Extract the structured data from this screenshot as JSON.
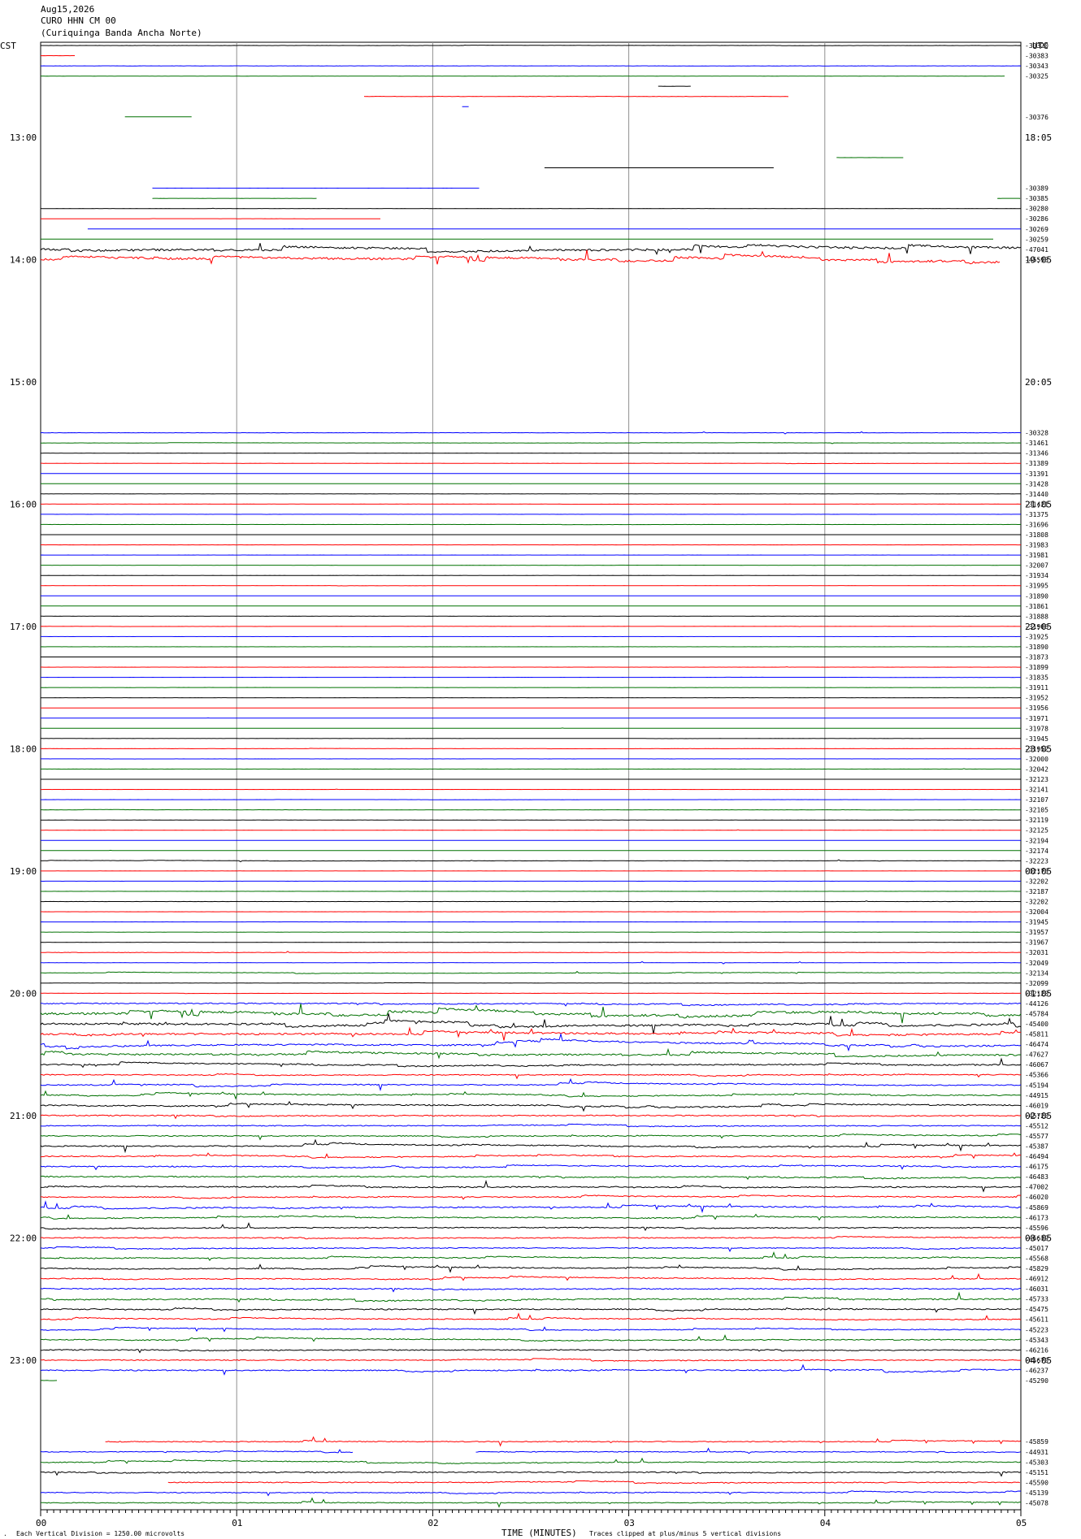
{
  "header": {
    "date": "Aug15,2026",
    "station": "CURO HHN CM 00",
    "location": "(Curiquinga Banda Ancha Norte)"
  },
  "left_tz": "CST",
  "right_tz": "UTC",
  "footer": {
    "scale": "Each Vertical Division = 1250.00 microvolts",
    "xlabel": "TIME (MINUTES)",
    "clip": "Traces clipped at plus/minus 5 vertical divisions"
  },
  "colors": {
    "cycle": [
      "#000000",
      "#ff0000",
      "#0000ff",
      "#007000"
    ],
    "grid": "#909090"
  },
  "chart_data": {
    "type": "line",
    "title": "",
    "xlabel": "TIME (MINUTES)",
    "xlim": [
      0,
      5
    ],
    "x_ticks": [
      "00",
      "01",
      "02",
      "03",
      "04",
      "05"
    ],
    "traces_per_hour": 12,
    "first_trace_hour": 12.25,
    "left_hour_labels": [
      "13:00",
      "14:00",
      "15:00",
      "16:00",
      "17:00",
      "18:00",
      "19:00",
      "20:00",
      "21:00",
      "22:00",
      "23:00"
    ],
    "right_hour_labels": [
      "18:05",
      "19:05",
      "20:05",
      "21:05",
      "22:05",
      "23:05",
      "00:05",
      "01:05",
      "02:05",
      "03:05",
      "04:05"
    ],
    "rows": [
      {
        "id": 0,
        "off": "-30320",
        "s": [
          [
            0,
            5
          ]
        ],
        "n": 0.2
      },
      {
        "id": 1,
        "off": "-30383",
        "s": [
          [
            0,
            0.18
          ]
        ],
        "n": 0.1
      },
      {
        "id": 2,
        "off": "-30343",
        "s": [
          [
            0,
            5
          ]
        ],
        "n": 0.2
      },
      {
        "id": 3,
        "off": "-30325",
        "s": [
          [
            0,
            4.92
          ]
        ],
        "n": 0.1
      },
      {
        "id": 4,
        "off": "",
        "s": [
          [
            3.15,
            3.32
          ]
        ],
        "n": 0.1
      },
      {
        "id": 5,
        "off": "",
        "s": [
          [
            1.65,
            3.82
          ]
        ],
        "n": 0.4
      },
      {
        "id": 6,
        "off": "",
        "s": [
          [
            2.15,
            2.19
          ]
        ],
        "n": 0.1
      },
      {
        "id": 7,
        "off": "-30376",
        "s": [
          [
            0.43,
            0.77
          ]
        ],
        "n": 0.1
      },
      {
        "id": 11,
        "off": "",
        "s": [
          [
            4.06,
            4.4
          ]
        ],
        "n": 0.1
      },
      {
        "id": 12,
        "off": "",
        "s": [
          [
            2.57,
            3.74
          ]
        ],
        "n": 0.1
      },
      {
        "id": 14,
        "off": "-30389",
        "s": [
          [
            0.57,
            2.24
          ]
        ],
        "n": 0.1
      },
      {
        "id": 15,
        "off": "-30385",
        "s": [
          [
            0.57,
            1.41
          ],
          [
            4.88,
            5
          ]
        ],
        "n": 0.1
      },
      {
        "id": 16,
        "off": "-30280",
        "s": [
          [
            0,
            5
          ]
        ],
        "n": 0.1
      },
      {
        "id": 17,
        "off": "-30286",
        "s": [
          [
            0,
            1.74
          ]
        ],
        "n": 0.1
      },
      {
        "id": 18,
        "off": "-30269",
        "s": [
          [
            0.24,
            5
          ]
        ],
        "n": 0.1
      },
      {
        "id": 19,
        "off": "-30259",
        "s": [
          [
            0,
            4.86
          ]
        ],
        "n": 0.1
      },
      {
        "id": 20,
        "off": "-47041",
        "s": [
          [
            0,
            5
          ]
        ],
        "n": 2.5
      },
      {
        "id": 21,
        "off": "-45593",
        "s": [
          [
            0,
            4.9
          ]
        ],
        "n": 2.5
      },
      {
        "id": 38,
        "off": "-30328",
        "s": [
          [
            0,
            5
          ]
        ],
        "n": 0.3
      },
      {
        "id": 39,
        "off": "-31461",
        "s": [
          [
            0,
            5
          ]
        ],
        "n": 0.2
      },
      {
        "id": 40,
        "off": "-31346",
        "s": [
          [
            0,
            5
          ]
        ],
        "n": 0.1
      },
      {
        "id": 41,
        "off": "-31389",
        "s": [
          [
            0,
            5
          ]
        ],
        "n": 0.3
      },
      {
        "id": 42,
        "off": "-31391",
        "s": [
          [
            0,
            5
          ]
        ],
        "n": 0.1
      },
      {
        "id": 43,
        "off": "-31428",
        "s": [
          [
            0,
            5
          ]
        ],
        "n": 0.1
      },
      {
        "id": 44,
        "off": "-31440",
        "s": [
          [
            0,
            5
          ]
        ],
        "n": 0.1
      },
      {
        "id": 45,
        "off": "-31421",
        "s": [
          [
            0,
            5
          ]
        ],
        "n": 0.1
      },
      {
        "id": 46,
        "off": "-31375",
        "s": [
          [
            0,
            5
          ]
        ],
        "n": 0.1
      },
      {
        "id": 47,
        "off": "-31696",
        "s": [
          [
            0,
            5
          ]
        ],
        "n": 0.2
      },
      {
        "id": 48,
        "off": "-31808",
        "s": [
          [
            0,
            5
          ]
        ],
        "n": 0.1
      },
      {
        "id": 49,
        "off": "-31983",
        "s": [
          [
            0,
            5
          ]
        ],
        "n": 0.1
      },
      {
        "id": 50,
        "off": "-31981",
        "s": [
          [
            0,
            5
          ]
        ],
        "n": 0.1
      },
      {
        "id": 51,
        "off": "-32007",
        "s": [
          [
            0,
            5
          ]
        ],
        "n": 0.1
      },
      {
        "id": 52,
        "off": "-31934",
        "s": [
          [
            0,
            5
          ]
        ],
        "n": 0.1
      },
      {
        "id": 53,
        "off": "-31995",
        "s": [
          [
            0,
            5
          ]
        ],
        "n": 0.2
      },
      {
        "id": 54,
        "off": "-31890",
        "s": [
          [
            0,
            5
          ]
        ],
        "n": 0.1
      },
      {
        "id": 55,
        "off": "-31861",
        "s": [
          [
            0,
            5
          ]
        ],
        "n": 0.1
      },
      {
        "id": 56,
        "off": "-31888",
        "s": [
          [
            0,
            5
          ]
        ],
        "n": 0.1
      },
      {
        "id": 57,
        "off": "-31906",
        "s": [
          [
            0,
            5
          ]
        ],
        "n": 0.1
      },
      {
        "id": 58,
        "off": "-31925",
        "s": [
          [
            0,
            5
          ]
        ],
        "n": 0.1
      },
      {
        "id": 59,
        "off": "-31890",
        "s": [
          [
            0,
            5
          ]
        ],
        "n": 0.1
      },
      {
        "id": 60,
        "off": "-31873",
        "s": [
          [
            0,
            5
          ]
        ],
        "n": 0.1
      },
      {
        "id": 61,
        "off": "-31899",
        "s": [
          [
            0,
            5
          ]
        ],
        "n": 0.1
      },
      {
        "id": 62,
        "off": "-31835",
        "s": [
          [
            0,
            5
          ]
        ],
        "n": 0.1
      },
      {
        "id": 63,
        "off": "-31911",
        "s": [
          [
            0,
            5
          ]
        ],
        "n": 0.1
      },
      {
        "id": 64,
        "off": "-31952",
        "s": [
          [
            0,
            5
          ]
        ],
        "n": 0.1
      },
      {
        "id": 65,
        "off": "-31956",
        "s": [
          [
            0,
            5
          ]
        ],
        "n": 0.1
      },
      {
        "id": 66,
        "off": "-31971",
        "s": [
          [
            0,
            5
          ]
        ],
        "n": 0.1
      },
      {
        "id": 67,
        "off": "-31978",
        "s": [
          [
            0,
            5
          ]
        ],
        "n": 0.1
      },
      {
        "id": 68,
        "off": "-31945",
        "s": [
          [
            0,
            5
          ]
        ],
        "n": 0.1
      },
      {
        "id": 69,
        "off": "-31952",
        "s": [
          [
            0,
            5
          ]
        ],
        "n": 0.2
      },
      {
        "id": 70,
        "off": "-32000",
        "s": [
          [
            0,
            5
          ]
        ],
        "n": 0.1
      },
      {
        "id": 71,
        "off": "-32042",
        "s": [
          [
            0,
            5
          ]
        ],
        "n": 0.2
      },
      {
        "id": 72,
        "off": "-32123",
        "s": [
          [
            0,
            5
          ]
        ],
        "n": 0.1
      },
      {
        "id": 73,
        "off": "-32141",
        "s": [
          [
            0,
            5
          ]
        ],
        "n": 0.1
      },
      {
        "id": 74,
        "off": "-32107",
        "s": [
          [
            0,
            5
          ]
        ],
        "n": 0.1
      },
      {
        "id": 75,
        "off": "-32105",
        "s": [
          [
            0,
            5
          ]
        ],
        "n": 0.2
      },
      {
        "id": 76,
        "off": "-32119",
        "s": [
          [
            0,
            5
          ]
        ],
        "n": 0.1
      },
      {
        "id": 77,
        "off": "-32125",
        "s": [
          [
            0,
            5
          ]
        ],
        "n": 0.2
      },
      {
        "id": 78,
        "off": "-32194",
        "s": [
          [
            0,
            5
          ]
        ],
        "n": 0.1
      },
      {
        "id": 79,
        "off": "-32174",
        "s": [
          [
            0,
            5
          ]
        ],
        "n": 0.1
      },
      {
        "id": 80,
        "off": "-32223",
        "s": [
          [
            0,
            5
          ]
        ],
        "n": 0.3
      },
      {
        "id": 81,
        "off": "-32173",
        "s": [
          [
            0,
            5
          ]
        ],
        "n": 0.1
      },
      {
        "id": 82,
        "off": "-32202",
        "s": [
          [
            0,
            5
          ]
        ],
        "n": 0.1
      },
      {
        "id": 83,
        "off": "-32187",
        "s": [
          [
            0,
            5
          ]
        ],
        "n": 0.1
      },
      {
        "id": 84,
        "off": "-32202",
        "s": [
          [
            0,
            5
          ]
        ],
        "n": 0.2
      },
      {
        "id": 85,
        "off": "-32004",
        "s": [
          [
            0,
            5
          ]
        ],
        "n": 0.1
      },
      {
        "id": 86,
        "off": "-31945",
        "s": [
          [
            0,
            5
          ]
        ],
        "n": 0.1
      },
      {
        "id": 87,
        "off": "-31957",
        "s": [
          [
            0,
            5
          ]
        ],
        "n": 0.1
      },
      {
        "id": 88,
        "off": "-31967",
        "s": [
          [
            0,
            5
          ]
        ],
        "n": 0.1
      },
      {
        "id": 89,
        "off": "-32031",
        "s": [
          [
            0,
            5
          ]
        ],
        "n": 0.5
      },
      {
        "id": 90,
        "off": "-32049",
        "s": [
          [
            0,
            5
          ]
        ],
        "n": 0.3
      },
      {
        "id": 91,
        "off": "-32134",
        "s": [
          [
            0,
            5
          ]
        ],
        "n": 0.5
      },
      {
        "id": 92,
        "off": "-32099",
        "s": [
          [
            0,
            5
          ]
        ],
        "n": 0.2
      },
      {
        "id": 93,
        "off": "-32120",
        "s": [
          [
            0,
            5
          ]
        ],
        "n": 0.2
      },
      {
        "id": 94,
        "off": "-44126",
        "s": [
          [
            0,
            5
          ]
        ],
        "n": 1.4
      },
      {
        "id": 95,
        "off": "-45784",
        "s": [
          [
            0,
            5
          ]
        ],
        "n": 2.6
      },
      {
        "id": 96,
        "off": "-45400",
        "s": [
          [
            0,
            5
          ]
        ],
        "n": 2.2
      },
      {
        "id": 97,
        "off": "-45811",
        "s": [
          [
            0,
            5
          ]
        ],
        "n": 2.2
      },
      {
        "id": 98,
        "off": "-46474",
        "s": [
          [
            0,
            5
          ]
        ],
        "n": 1.8
      },
      {
        "id": 99,
        "off": "-47627",
        "s": [
          [
            0,
            5
          ]
        ],
        "n": 2.0
      },
      {
        "id": 100,
        "off": "-46067",
        "s": [
          [
            0,
            5
          ]
        ],
        "n": 1.5
      },
      {
        "id": 101,
        "off": "-45366",
        "s": [
          [
            0,
            5
          ]
        ],
        "n": 1.2
      },
      {
        "id": 102,
        "off": "-45194",
        "s": [
          [
            0,
            5
          ]
        ],
        "n": 1.3
      },
      {
        "id": 103,
        "off": "-44915",
        "s": [
          [
            0,
            5
          ]
        ],
        "n": 1.3
      },
      {
        "id": 104,
        "off": "-46019",
        "s": [
          [
            0,
            5
          ]
        ],
        "n": 1.5
      },
      {
        "id": 105,
        "off": "-45720",
        "s": [
          [
            0,
            5
          ]
        ],
        "n": 1.3
      },
      {
        "id": 106,
        "off": "-45512",
        "s": [
          [
            0,
            5
          ]
        ],
        "n": 1.1
      },
      {
        "id": 107,
        "off": "-45577",
        "s": [
          [
            0,
            5
          ]
        ],
        "n": 1.2
      },
      {
        "id": 108,
        "off": "-45387",
        "s": [
          [
            0,
            5
          ]
        ],
        "n": 1.4
      },
      {
        "id": 109,
        "off": "-46494",
        "s": [
          [
            0,
            5
          ]
        ],
        "n": 1.3
      },
      {
        "id": 110,
        "off": "-46175",
        "s": [
          [
            0,
            5
          ]
        ],
        "n": 1.3
      },
      {
        "id": 111,
        "off": "-46483",
        "s": [
          [
            0,
            5
          ]
        ],
        "n": 1.4
      },
      {
        "id": 112,
        "off": "-47002",
        "s": [
          [
            0,
            5
          ]
        ],
        "n": 1.5
      },
      {
        "id": 113,
        "off": "-46020",
        "s": [
          [
            0,
            5
          ]
        ],
        "n": 1.2
      },
      {
        "id": 114,
        "off": "-45869",
        "s": [
          [
            0,
            5
          ]
        ],
        "n": 1.5
      },
      {
        "id": 115,
        "off": "-46173",
        "s": [
          [
            0,
            5
          ]
        ],
        "n": 1.3
      },
      {
        "id": 116,
        "off": "-45596",
        "s": [
          [
            0,
            5
          ]
        ],
        "n": 1.2
      },
      {
        "id": 117,
        "off": "-46639",
        "s": [
          [
            0,
            5
          ]
        ],
        "n": 1.2
      },
      {
        "id": 118,
        "off": "-45017",
        "s": [
          [
            0,
            5
          ]
        ],
        "n": 1.1
      },
      {
        "id": 119,
        "off": "-45568",
        "s": [
          [
            0,
            5
          ]
        ],
        "n": 1.2
      },
      {
        "id": 120,
        "off": "-45829",
        "s": [
          [
            0,
            5
          ]
        ],
        "n": 1.3
      },
      {
        "id": 121,
        "off": "-46912",
        "s": [
          [
            0,
            5
          ]
        ],
        "n": 1.2
      },
      {
        "id": 122,
        "off": "-46031",
        "s": [
          [
            0,
            5
          ]
        ],
        "n": 1.3
      },
      {
        "id": 123,
        "off": "-45733",
        "s": [
          [
            0,
            5
          ]
        ],
        "n": 1.6
      },
      {
        "id": 124,
        "off": "-45475",
        "s": [
          [
            0,
            5
          ]
        ],
        "n": 1.5
      },
      {
        "id": 125,
        "off": "-45611",
        "s": [
          [
            0,
            5
          ]
        ],
        "n": 1.2
      },
      {
        "id": 126,
        "off": "-45223",
        "s": [
          [
            0,
            5
          ]
        ],
        "n": 1.1
      },
      {
        "id": 127,
        "off": "-45343",
        "s": [
          [
            0,
            5
          ]
        ],
        "n": 1.2
      },
      {
        "id": 128,
        "off": "-46216",
        "s": [
          [
            0,
            5
          ]
        ],
        "n": 1.2
      },
      {
        "id": 129,
        "off": "-45670",
        "s": [
          [
            0,
            5
          ]
        ],
        "n": 1.1
      },
      {
        "id": 130,
        "off": "-46237",
        "s": [
          [
            0,
            5
          ]
        ],
        "n": 1.4
      },
      {
        "id": 131,
        "off": "-45290",
        "s": [
          [
            0,
            0.09
          ]
        ],
        "n": 0.4
      },
      {
        "id": 137,
        "off": "-45859",
        "s": [
          [
            0.33,
            5
          ]
        ],
        "n": 1.0
      },
      {
        "id": 138,
        "off": "-44931",
        "s": [
          [
            0,
            1.6
          ],
          [
            2.22,
            5
          ]
        ],
        "n": 1.0
      },
      {
        "id": 139,
        "off": "-45303",
        "s": [
          [
            0,
            5
          ]
        ],
        "n": 1.0
      },
      {
        "id": 140,
        "off": "-45151",
        "s": [
          [
            0,
            5
          ]
        ],
        "n": 1.3
      },
      {
        "id": 141,
        "off": "-45590",
        "s": [
          [
            0.65,
            5
          ]
        ],
        "n": 1.1
      },
      {
        "id": 142,
        "off": "-45139",
        "s": [
          [
            0,
            5
          ]
        ],
        "n": 1.0
      },
      {
        "id": 143,
        "off": "-45078",
        "s": [
          [
            0,
            5
          ]
        ],
        "n": 1.0
      }
    ]
  }
}
